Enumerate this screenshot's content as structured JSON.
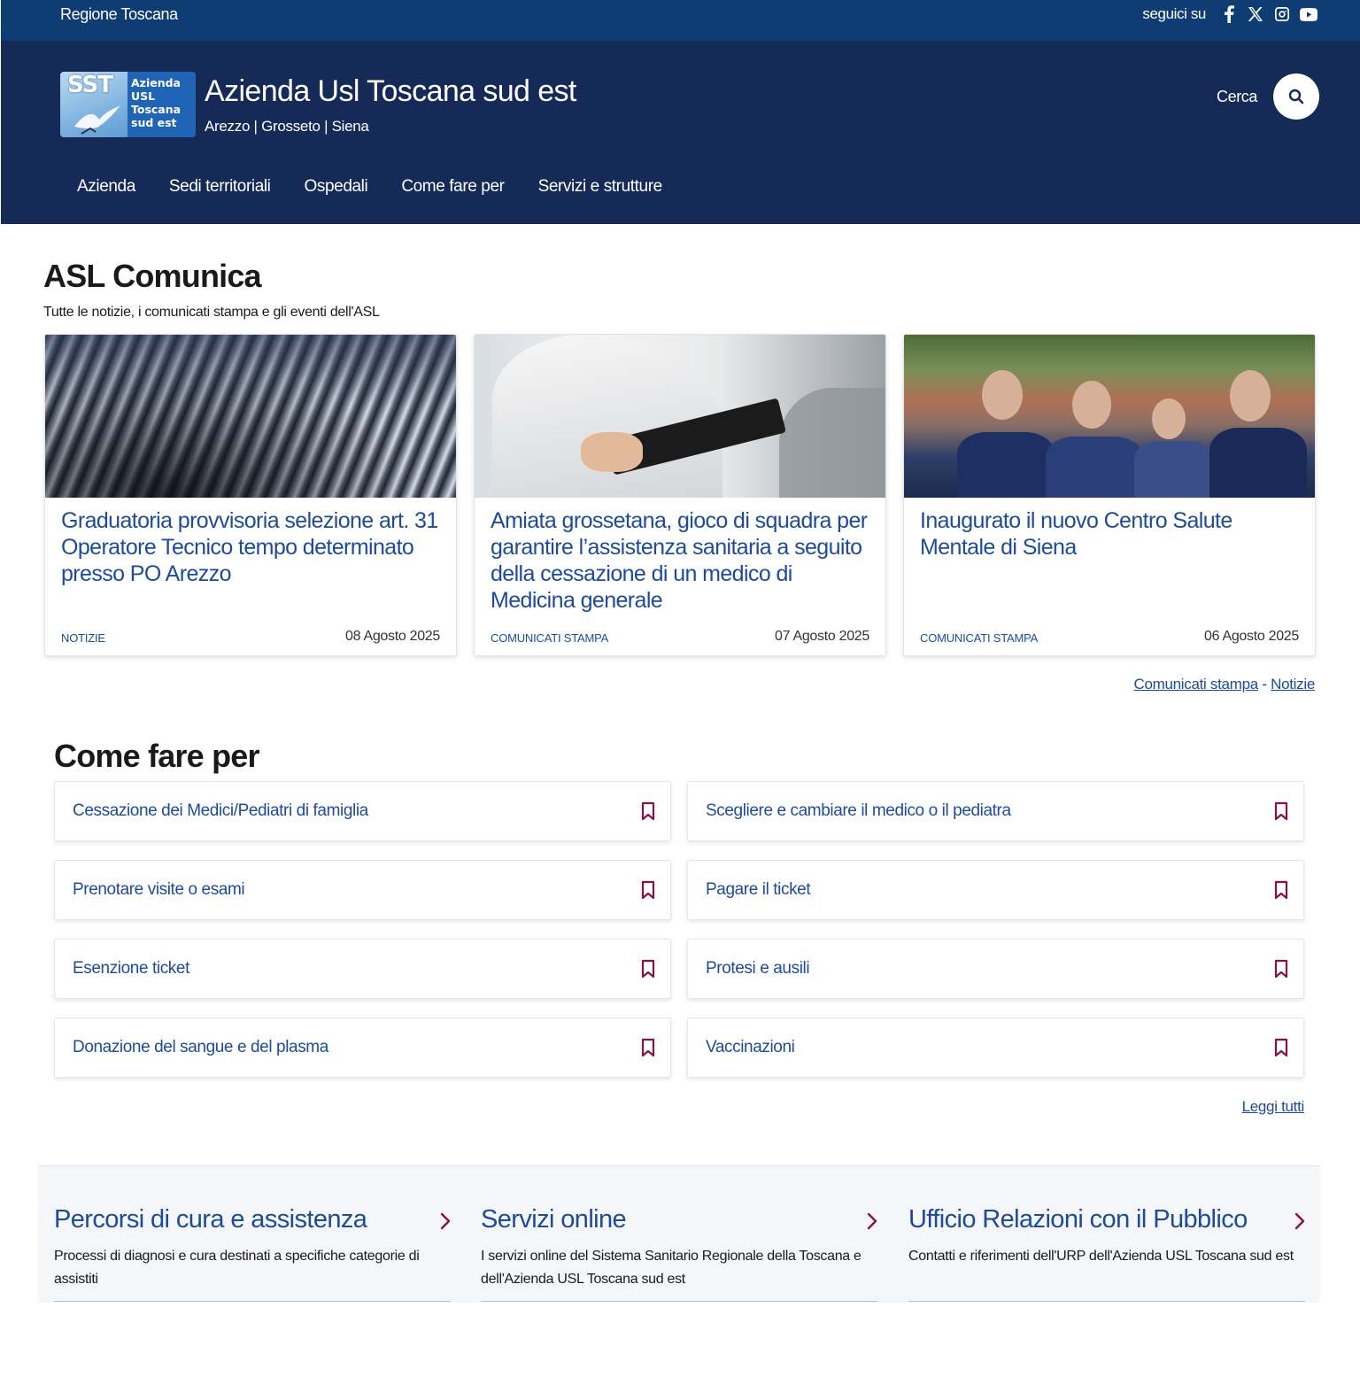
{
  "topbar": {
    "region": "Regione Toscana",
    "follow_label": "seguici su",
    "social": [
      "facebook-icon",
      "x-icon",
      "instagram-icon",
      "youtube-icon"
    ]
  },
  "header": {
    "logo_mark": "SST",
    "logo_text": [
      "Azienda",
      "USL",
      "Toscana",
      "sud est"
    ],
    "title": "Azienda Usl Toscana sud est",
    "subtitle": "Arezzo | Grosseto | Siena",
    "search_label": "Cerca",
    "nav": [
      "Azienda",
      "Sedi territoriali",
      "Ospedali",
      "Come fare per",
      "Servizi e strutture"
    ]
  },
  "comunica": {
    "title": "ASL Comunica",
    "subtitle": "Tutte le notizie, i comunicati stampa e gli eventi dell'ASL",
    "cards": [
      {
        "title": "Graduatoria provvisoria selezione art. 31 Operatore Tecnico tempo determinato presso PO Arezzo",
        "category": "NOTIZIE",
        "date": "08 Agosto 2025"
      },
      {
        "title": "Amiata grossetana, gioco di squadra per garantire l’assistenza sanitaria a seguito della cessazione di un medico di Medicina generale",
        "category": "COMUNICATI STAMPA",
        "date": "07 Agosto 2025"
      },
      {
        "title": "Inaugurato il nuovo Centro Salute Mentale di Siena",
        "category": "COMUNICATI STAMPA",
        "date": "06 Agosto 2025"
      }
    ],
    "links": {
      "comunicati": "Comunicati stampa",
      "separator": "-",
      "notizie": "Notizie"
    }
  },
  "come_fare": {
    "title": "Come fare per",
    "items": [
      "Cessazione dei Medici/Pediatri di famiglia",
      "Scegliere e cambiare il medico o il pediatra",
      "Prenotare visite o esami",
      "Pagare il ticket",
      "Esenzione ticket",
      "Protesi e ausili",
      "Donazione del sangue e del plasma",
      "Vaccinazioni"
    ],
    "read_all": "Leggi tutti"
  },
  "bottom": [
    {
      "title": "Percorsi di cura e assistenza",
      "desc": "Processi di diagnosi e cura destinati a specifiche categorie di assistiti"
    },
    {
      "title": "Servizi online",
      "desc": "I servizi online del Sistema Sanitario Regionale della Toscana e dell'Azienda USL Toscana sud est"
    },
    {
      "title": "Ufficio Relazioni con il Pubblico",
      "desc": "Contatti e riferimenti dell'URP dell'Azienda USL Toscana sud est"
    }
  ],
  "colors": {
    "topbar": "#0e3c73",
    "header": "#152a57",
    "link_blue": "#1e4b99",
    "bookmark": "#8a1048"
  }
}
